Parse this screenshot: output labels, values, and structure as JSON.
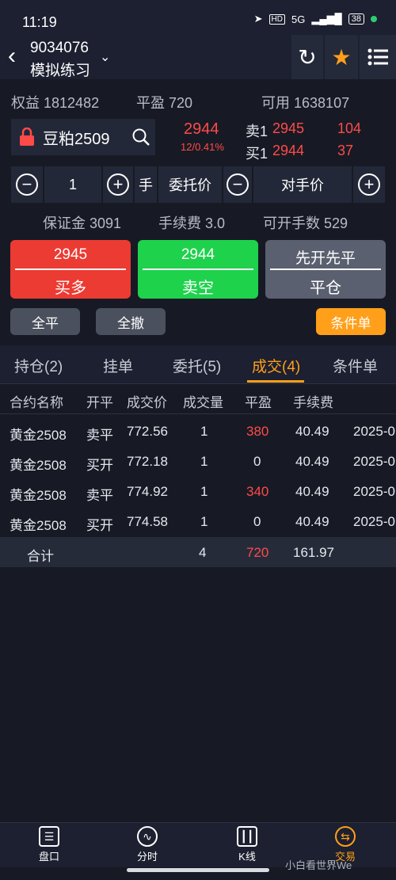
{
  "status": {
    "time": "11:19",
    "network": "5G",
    "battery": "38"
  },
  "header": {
    "account": "9034076",
    "mode": "模拟练习"
  },
  "account_summary": {
    "equity_label": "权益",
    "equity": "1812482",
    "pnl_label": "平盈",
    "pnl": "720",
    "avail_label": "可用",
    "avail": "1638107"
  },
  "contract": {
    "name": "豆粕2509",
    "last": "2944",
    "change": "12/0.41%"
  },
  "orderbook": {
    "ask_label": "卖1",
    "ask_price": "2945",
    "ask_vol": "104",
    "bid_label": "买1",
    "bid_price": "2944",
    "bid_vol": "37"
  },
  "controls": {
    "qty": "1",
    "qty_unit": "手",
    "price_type_label": "委托价",
    "price_value": "对手价"
  },
  "fees": {
    "margin_label": "保证金",
    "margin": "3091",
    "fee_label": "手续费",
    "fee": "3.0",
    "max_label": "可开手数",
    "max": "529"
  },
  "buttons": {
    "buy_price": "2945",
    "buy_label": "买多",
    "sell_price": "2944",
    "sell_label": "卖空",
    "close_top": "先开先平",
    "close_label": "平仓",
    "close_all": "全平",
    "cancel_all": "全撤",
    "conditional": "条件单"
  },
  "tabs": [
    "持仓(2)",
    "挂单",
    "委托(5)",
    "成交(4)",
    "条件单"
  ],
  "table": {
    "headers": [
      "合约名称",
      "开平",
      "成交价",
      "成交量",
      "平盈",
      "手续费"
    ],
    "rows": [
      [
        "黄金2508",
        "卖平",
        "772.56",
        "1",
        "380",
        "40.49",
        "2025-0"
      ],
      [
        "黄金2508",
        "买开",
        "772.18",
        "1",
        "0",
        "40.49",
        "2025-0"
      ],
      [
        "黄金2508",
        "卖平",
        "774.92",
        "1",
        "340",
        "40.49",
        "2025-0"
      ],
      [
        "黄金2508",
        "买开",
        "774.58",
        "1",
        "0",
        "40.49",
        "2025-0"
      ]
    ],
    "total": {
      "label": "合计",
      "volume": "4",
      "pnl": "720",
      "fee": "161.97"
    }
  },
  "bottom_nav": [
    "盘口",
    "分时",
    "K线",
    "交易"
  ],
  "watermark": "小白看世界We",
  "colors": {
    "up": "#ff4a4a",
    "buy": "#ec3b33",
    "sell": "#1ed24c",
    "accent": "#ff9f1a"
  }
}
